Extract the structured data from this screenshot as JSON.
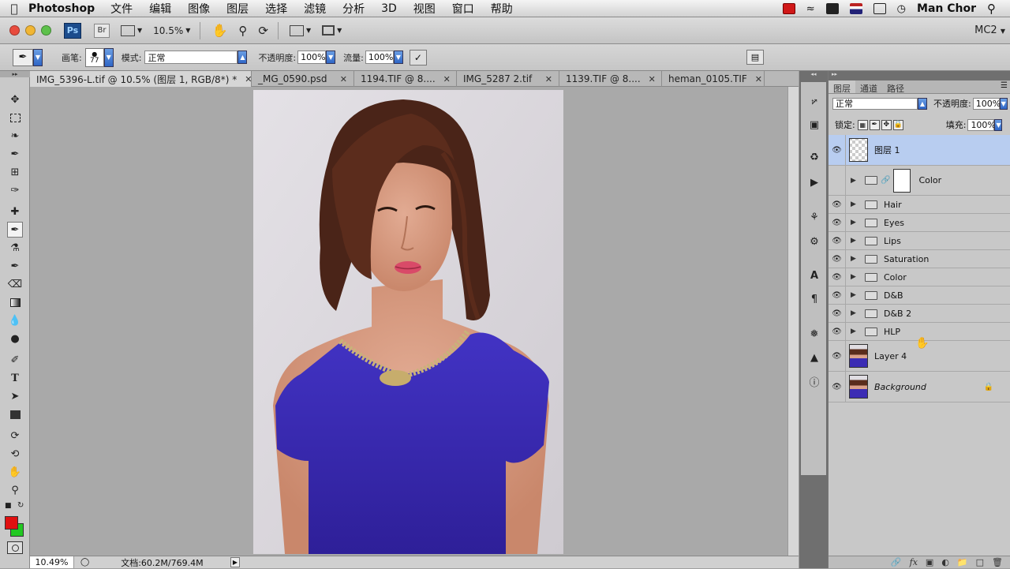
{
  "menubar": {
    "app_name": "Photoshop",
    "menus": [
      "文件",
      "编辑",
      "图像",
      "图层",
      "选择",
      "滤镜",
      "分析",
      "3D",
      "视图",
      "窗口",
      "帮助"
    ],
    "user": "Man Chor"
  },
  "appbar": {
    "ps_label": "Ps",
    "br_label": "Br",
    "zoom": "10.5%",
    "workspace": "MC2"
  },
  "options": {
    "brush_label": "画笔:",
    "brush_size": "77",
    "mode_label": "模式:",
    "mode_value": "正常",
    "opacity_label": "不透明度:",
    "opacity_value": "100%",
    "flow_label": "流量:",
    "flow_value": "100%"
  },
  "tabs": [
    {
      "label": "IMG_5396-L.tif @ 10.5% (图层 1, RGB/8*) *"
    },
    {
      "label": "_MG_0590.psd"
    },
    {
      "label": "1194.TIF @ 8...."
    },
    {
      "label": "IMG_5287 2.tif"
    },
    {
      "label": "1139.TIF @ 8...."
    },
    {
      "label": "heman_0105.TIF"
    }
  ],
  "tab_close": "✕",
  "status": {
    "zoom": "10.49%",
    "doc_info": "文档:60.2M/769.4M"
  },
  "panel": {
    "tabs": [
      "图层",
      "通道",
      "路径"
    ],
    "blend_mode": "正常",
    "opacity_label": "不透明度:",
    "opacity_value": "100%",
    "lock_label": "锁定:",
    "fill_label": "填充:",
    "fill_value": "100%"
  },
  "layers": [
    {
      "name": "图层 1",
      "kind": "pixel-empty",
      "visible": true,
      "selected": true
    },
    {
      "name": "Color",
      "kind": "group-mask",
      "visible": false,
      "selected": false
    },
    {
      "name": "Hair",
      "kind": "group",
      "visible": true,
      "selected": false
    },
    {
      "name": "Eyes",
      "kind": "group",
      "visible": true,
      "selected": false
    },
    {
      "name": "Lips",
      "kind": "group",
      "visible": true,
      "selected": false
    },
    {
      "name": "Saturation",
      "kind": "group",
      "visible": true,
      "selected": false
    },
    {
      "name": "Color",
      "kind": "group",
      "visible": true,
      "selected": false
    },
    {
      "name": "D&B",
      "kind": "group",
      "visible": true,
      "selected": false
    },
    {
      "name": "D&B 2",
      "kind": "group",
      "visible": true,
      "selected": false
    },
    {
      "name": "HLP",
      "kind": "group",
      "visible": true,
      "selected": false
    },
    {
      "name": "Layer 4",
      "kind": "photo",
      "visible": true,
      "selected": false
    },
    {
      "name": "Background",
      "kind": "photo-locked",
      "visible": true,
      "selected": false
    }
  ],
  "colors": {
    "foreground": "#e01010",
    "background": "#22c822",
    "selected_layer": "#b8cdf0",
    "dress": "#3a2bb0"
  }
}
